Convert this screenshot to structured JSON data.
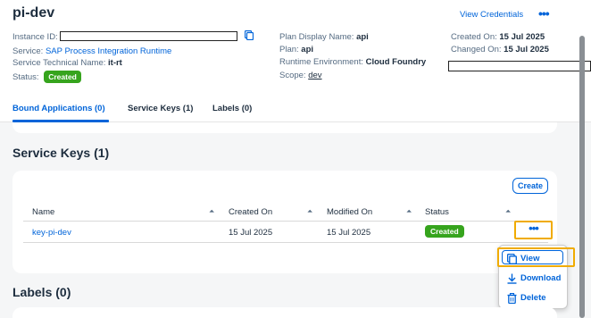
{
  "header": {
    "title": "pi-dev",
    "view_credentials": "View Credentials",
    "more": "•••",
    "fields": {
      "instance_id_label": "Instance ID:",
      "service_label": "Service:",
      "service_value": "SAP Process Integration Runtime",
      "tech_name_label": "Service Technical Name:",
      "tech_name_value": "it-rt",
      "status_label": "Status:",
      "status_value": "Created",
      "plan_display_label": "Plan Display Name:",
      "plan_display_value": "api",
      "plan_label": "Plan:",
      "plan_value": "api",
      "runtime_label": "Runtime Environment:",
      "runtime_value": "Cloud Foundry",
      "scope_label": "Scope:",
      "scope_value": "dev",
      "created_on_label": "Created On:",
      "created_on_value": "15 Jul 2025",
      "changed_on_label": "Changed On:",
      "changed_on_value": "15 Jul 2025"
    }
  },
  "tabs": [
    {
      "label": "Bound Applications (0)",
      "active": true
    },
    {
      "label": "Service Keys (1)",
      "active": false
    },
    {
      "label": "Labels (0)",
      "active": false
    }
  ],
  "service_keys": {
    "title": "Service Keys (1)",
    "create_label": "Create",
    "columns": [
      "Name",
      "Created On",
      "Modified On",
      "Status"
    ],
    "rows": [
      {
        "name": "key-pi-dev",
        "created_on": "15 Jul 2025",
        "modified_on": "15 Jul 2025",
        "status": "Created"
      }
    ],
    "row_more": "•••",
    "menu": [
      {
        "label": "View",
        "icon": "copy-icon"
      },
      {
        "label": "Download",
        "icon": "download-icon"
      },
      {
        "label": "Delete",
        "icon": "trash-icon"
      }
    ]
  },
  "labels_section": {
    "title": "Labels (0)"
  },
  "colors": {
    "accent": "#0064d9",
    "success": "#36a41d",
    "highlight": "#f0ab00"
  }
}
